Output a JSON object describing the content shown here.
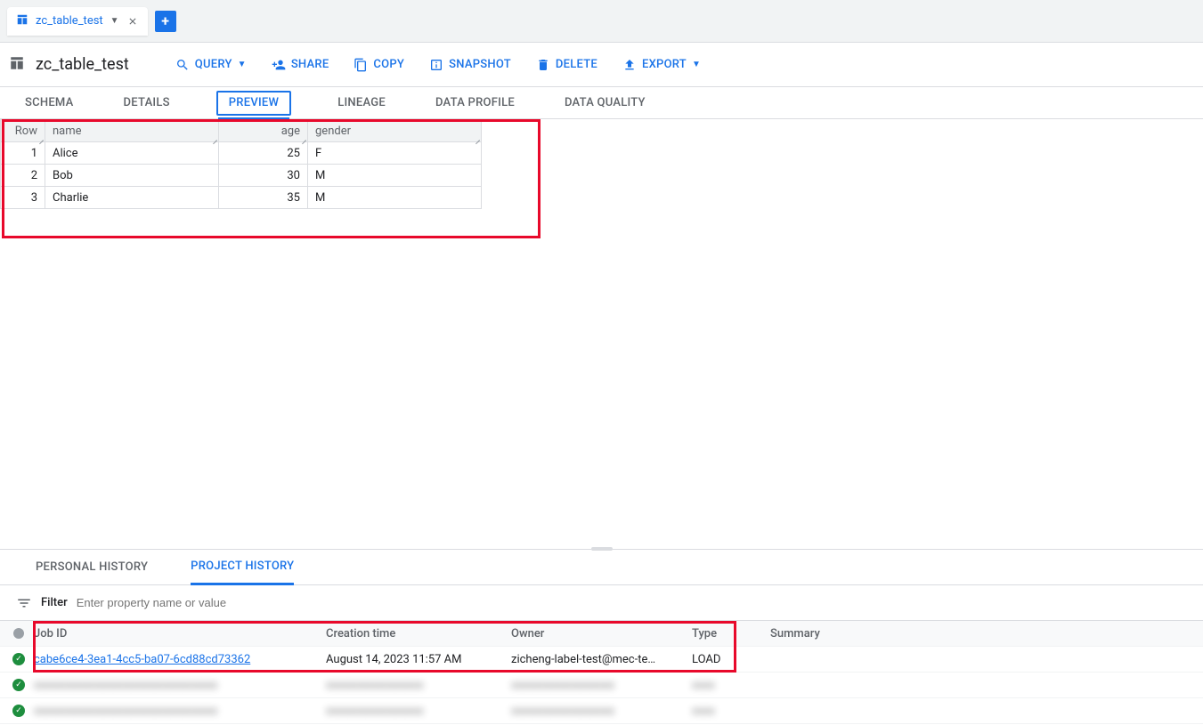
{
  "tabbar": {
    "tabs": [
      {
        "label": "zc_table_test"
      }
    ]
  },
  "header": {
    "title": "zc_table_test",
    "actions": {
      "query": "QUERY",
      "share": "SHARE",
      "copy": "COPY",
      "snapshot": "SNAPSHOT",
      "delete": "DELETE",
      "export": "EXPORT"
    }
  },
  "subtabs": {
    "schema": "SCHEMA",
    "details": "DETAILS",
    "preview": "PREVIEW",
    "lineage": "LINEAGE",
    "data_profile": "DATA PROFILE",
    "data_quality": "DATA QUALITY"
  },
  "preview_table": {
    "headers": {
      "row": "Row",
      "name": "name",
      "age": "age",
      "gender": "gender"
    },
    "rows": [
      {
        "row": "1",
        "name": "Alice",
        "age": "25",
        "gender": "F"
      },
      {
        "row": "2",
        "name": "Bob",
        "age": "30",
        "gender": "M"
      },
      {
        "row": "3",
        "name": "Charlie",
        "age": "35",
        "gender": "M"
      }
    ]
  },
  "history": {
    "tabs": {
      "personal": "PERSONAL HISTORY",
      "project": "PROJECT HISTORY"
    },
    "filter_label": "Filter",
    "filter_placeholder": "Enter property name or value",
    "columns": {
      "job_id": "Job ID",
      "creation_time": "Creation time",
      "owner": "Owner",
      "type": "Type",
      "summary": "Summary"
    },
    "jobs": [
      {
        "status": "ok",
        "job_id": "cabe6ce4-3ea1-4cc5-ba07-6cd88cd73362",
        "creation_time": "August 14, 2023 11:57 AM",
        "owner": "zicheng-label-test@mec-te…",
        "type": "LOAD",
        "summary": ""
      },
      {
        "status": "ok",
        "job_id": "xxxxxxxxxxxxxxxxxxxxxxxxxxxxxxxx",
        "creation_time": "xxxxxxxxxxxxxxxxx",
        "owner": "xxxxxxxxxxxxxxxxxx",
        "type": "xxxx",
        "summary": "",
        "blur": true
      },
      {
        "status": "ok",
        "job_id": "xxxxxxxxxxxxxxxxxxxxxxxxxxxxxxxx",
        "creation_time": "xxxxxxxxxxxxxxxxx",
        "owner": "xxxxxxxxxxxxxxxxxx",
        "type": "xxxx",
        "summary": "",
        "blur": true
      }
    ]
  }
}
